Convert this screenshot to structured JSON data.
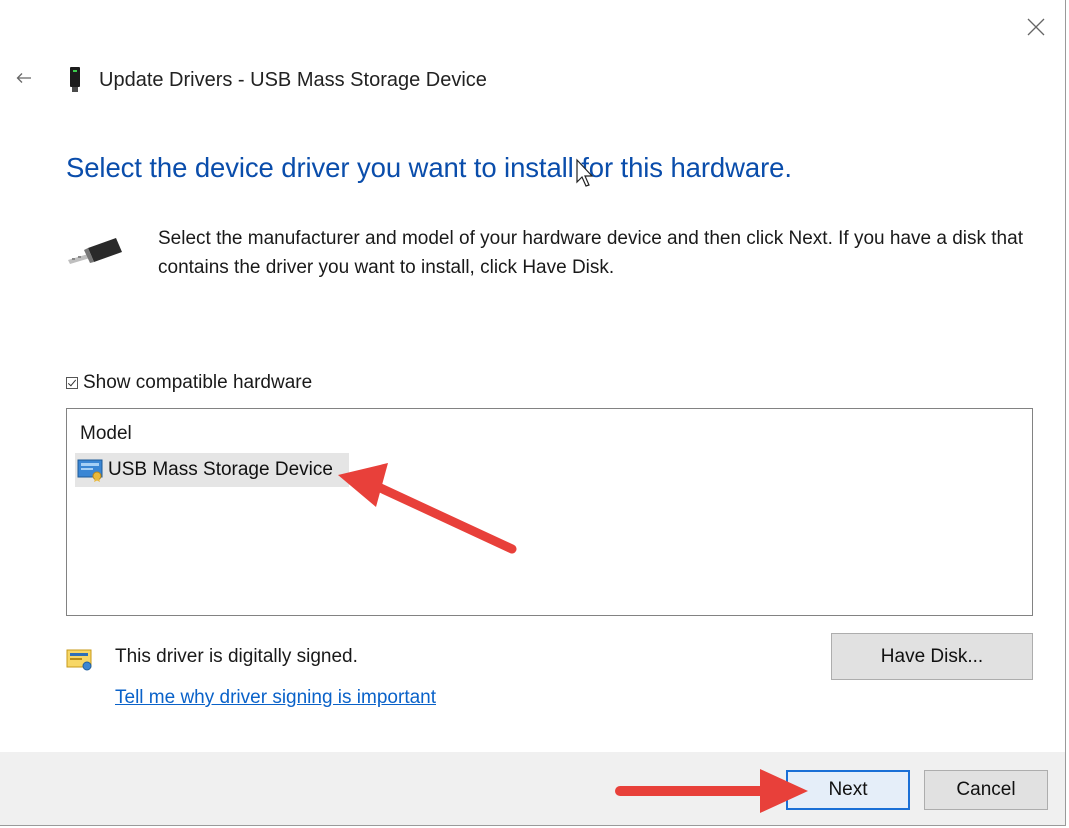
{
  "window": {
    "title": "Update Drivers - USB Mass Storage Device",
    "back_icon": "back-arrow-icon",
    "close_icon": "close-icon"
  },
  "main": {
    "heading": "Select the device driver you want to install for this hardware.",
    "instructions": "Select the manufacturer and model of your hardware device and then click Next. If you have a disk that contains the driver you want to install, click Have Disk.",
    "show_compatible_label": "Show compatible hardware",
    "show_compatible_checked": true
  },
  "model_list": {
    "header": "Model",
    "items": [
      {
        "label": "USB Mass Storage Device",
        "selected": true
      }
    ]
  },
  "signing": {
    "status_text": "This driver is digitally signed.",
    "link_text": "Tell me why driver signing is important"
  },
  "buttons": {
    "have_disk": "Have Disk...",
    "next": "Next",
    "cancel": "Cancel"
  },
  "colors": {
    "heading": "#0a4dab",
    "link": "#0a62c9",
    "annotation_arrow": "#e8403a",
    "footer_bg": "#f0f0f0"
  }
}
